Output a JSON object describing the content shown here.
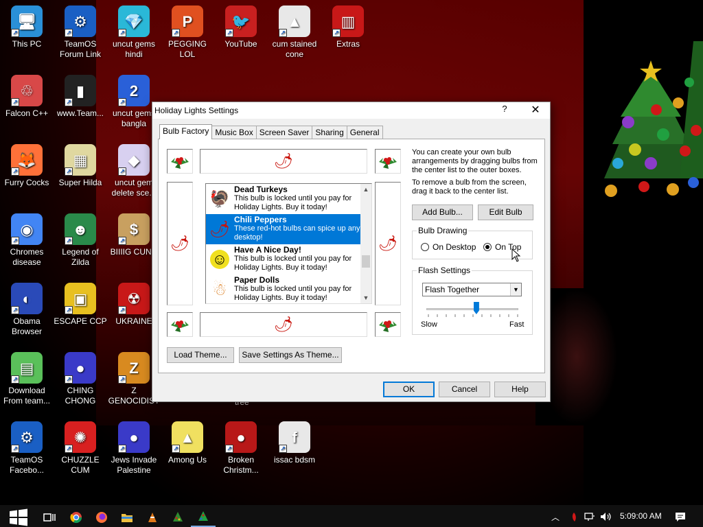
{
  "desktop": {
    "icons": [
      {
        "label": "This PC",
        "glyph": "🖥"
      },
      {
        "label": "TeamOS Forum Link",
        "glyph": "⚙"
      },
      {
        "label": "uncut gems hindi",
        "glyph": "💎"
      },
      {
        "label": "PEGGING LOL",
        "glyph": "P"
      },
      {
        "label": "YouTube",
        "glyph": "🐦"
      },
      {
        "label": "cum stained cone",
        "glyph": "▲"
      },
      {
        "label": "Extras",
        "glyph": "▥"
      },
      {
        "label": "Falcon C++",
        "glyph": "♲"
      },
      {
        "label": "www.Team...",
        "glyph": "▮"
      },
      {
        "label": "uncut gems bangla",
        "glyph": "2"
      },
      {
        "label": "Furry Cocks",
        "glyph": "🦊"
      },
      {
        "label": "Super Hilda",
        "glyph": "▦"
      },
      {
        "label": "uncut gem delete sce...",
        "glyph": "◆"
      },
      {
        "label": "Chromes disease",
        "glyph": "◉"
      },
      {
        "label": "Legend of Zilda",
        "glyph": "☻"
      },
      {
        "label": "BIIIIG CUNN",
        "glyph": "$"
      },
      {
        "label": "Obama Browser",
        "glyph": "◐"
      },
      {
        "label": "ESCAPE CCP",
        "glyph": "▣"
      },
      {
        "label": "UKRAINE",
        "glyph": "☢"
      },
      {
        "label": "Download From team...",
        "glyph": "▤"
      },
      {
        "label": "CHING CHONG",
        "glyph": "●"
      },
      {
        "label": "Z GENOCIDIST",
        "glyph": "Z"
      },
      {
        "label": "TeamOS Facebo...",
        "glyph": "⚙"
      },
      {
        "label": "CHUZZLE CUM",
        "glyph": "✺"
      },
      {
        "label": "Jews Invade Palestine",
        "glyph": "●"
      },
      {
        "label": "Among Us",
        "glyph": "▲"
      },
      {
        "label": "Broken Christm...",
        "glyph": "●"
      },
      {
        "label": "issac bdsm",
        "glyph": "f"
      }
    ],
    "partial_label": "tree"
  },
  "dialog": {
    "title": "Holiday Lights Settings",
    "help_glyph": "?",
    "close_glyph": "✕",
    "tabs": [
      "Bulb Factory",
      "Music Box",
      "Screen Saver",
      "Sharing",
      "General"
    ],
    "active_tab": "Bulb Factory",
    "bulbs": [
      {
        "name": "Dead Turkeys",
        "desc": "This bulb is locked until you pay for Holiday Lights. Buy it today!",
        "icon": "turkey-icon",
        "selected": false
      },
      {
        "name": "Chili Peppers",
        "desc": "These red-hot bulbs can spice up any desktop!",
        "icon": "chili-pepper-icon",
        "selected": true
      },
      {
        "name": "Have A Nice Day!",
        "desc": "This bulb is locked until you pay for Holiday Lights. Buy it today!",
        "icon": "smiley-icon",
        "selected": false
      },
      {
        "name": "Paper Dolls",
        "desc": "This bulb is locked until you pay for Holiday Lights. Buy it today!",
        "icon": "paper-doll-icon",
        "selected": false
      }
    ],
    "info_text_1": "You can create your own bulb arrangements by dragging bulbs from the center list to the outer boxes.",
    "info_text_2": "To remove a bulb from the screen, drag it back to the center list.",
    "add_bulb": "Add Bulb...",
    "edit_bulb": "Edit  Bulb",
    "bulb_drawing": {
      "legend": "Bulb Drawing",
      "options": [
        "On Desktop",
        "On Top"
      ],
      "selected": "On Top"
    },
    "flash_settings": {
      "legend": "Flash Settings",
      "mode": "Flash Together",
      "speed_min_label": "Slow",
      "speed_max_label": "Fast",
      "speed_fraction": 0.53
    },
    "load_theme": "Load Theme...",
    "save_theme": "Save Settings As Theme...",
    "ok": "OK",
    "cancel": "Cancel",
    "help": "Help"
  },
  "taskbar": {
    "clock": "5:09:00 AM",
    "pinned": [
      "start-icon",
      "task-view-icon",
      "chrome-icon",
      "firefox-icon",
      "file-explorer-icon",
      "cone-icon",
      "tree-icon",
      "christmas-tree-icon"
    ]
  },
  "colors": {
    "selection": "#0078d7",
    "pepper": "#c8140c",
    "holly_green": "#2f8a2f",
    "berry": "#d01818"
  }
}
